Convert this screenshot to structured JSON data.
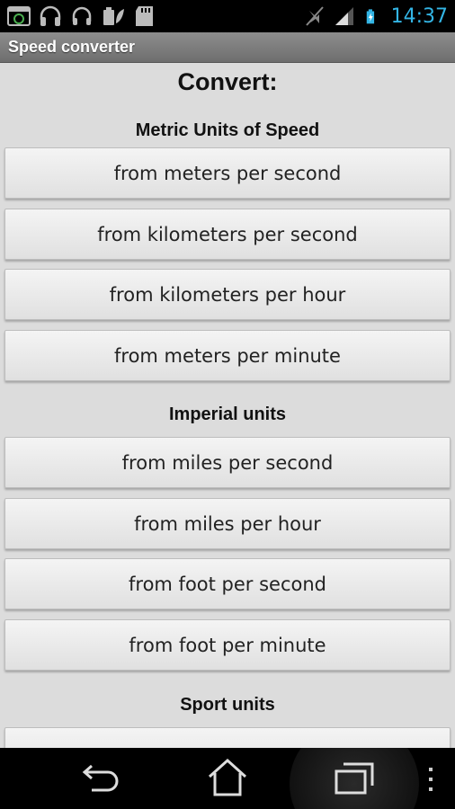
{
  "status_bar": {
    "time": "14:37",
    "icons": [
      "gallery-icon",
      "headphones-icon",
      "headset-icon",
      "battery-saver-icon",
      "sd-card-icon",
      "mute-icon",
      "signal-icon",
      "battery-charging-icon"
    ]
  },
  "title_bar": {
    "title": "Speed converter"
  },
  "main": {
    "heading": "Convert:",
    "sections": [
      {
        "title": "Metric Units of Speed",
        "buttons": [
          "from meters per second",
          "from kilometers per second",
          "from kilometers per hour",
          "from meters per minute"
        ]
      },
      {
        "title": "Imperial units",
        "buttons": [
          "from miles per second",
          "from miles per hour",
          "from foot per second",
          "from foot per minute"
        ]
      },
      {
        "title": "Sport units"
      }
    ]
  },
  "nav_bar": {
    "icons": [
      "back-icon",
      "home-icon",
      "recent-apps-icon",
      "overflow-menu-icon"
    ]
  },
  "colors": {
    "clock": "#33b5e5",
    "content_bg": "#dcdcdc",
    "title_bar": "#7d7d7d"
  }
}
